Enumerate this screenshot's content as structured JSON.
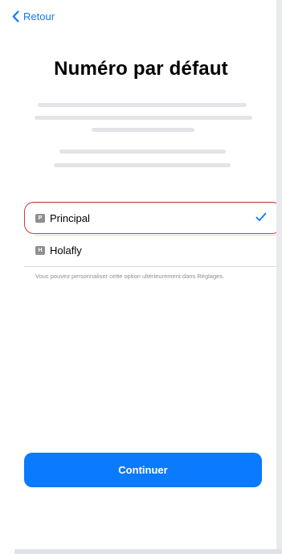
{
  "nav": {
    "back_label": "Retour"
  },
  "title": "Numéro par défaut",
  "options": [
    {
      "badge": "P",
      "label": "Principal",
      "selected": true
    },
    {
      "badge": "H",
      "label": "Holafly",
      "selected": false
    }
  ],
  "hint": "Vous pouvez personnaliser cette option ultérieurement dans Réglages.",
  "continue_label": "Continuer",
  "colors": {
    "accent": "#0a7aff",
    "highlight_border": "#d43b3b",
    "placeholder_bar": "#e3e4e8",
    "sim_badge": "#8e8e93"
  },
  "icons": {
    "back": "chevron-left-icon",
    "selected": "checkmark-icon"
  }
}
